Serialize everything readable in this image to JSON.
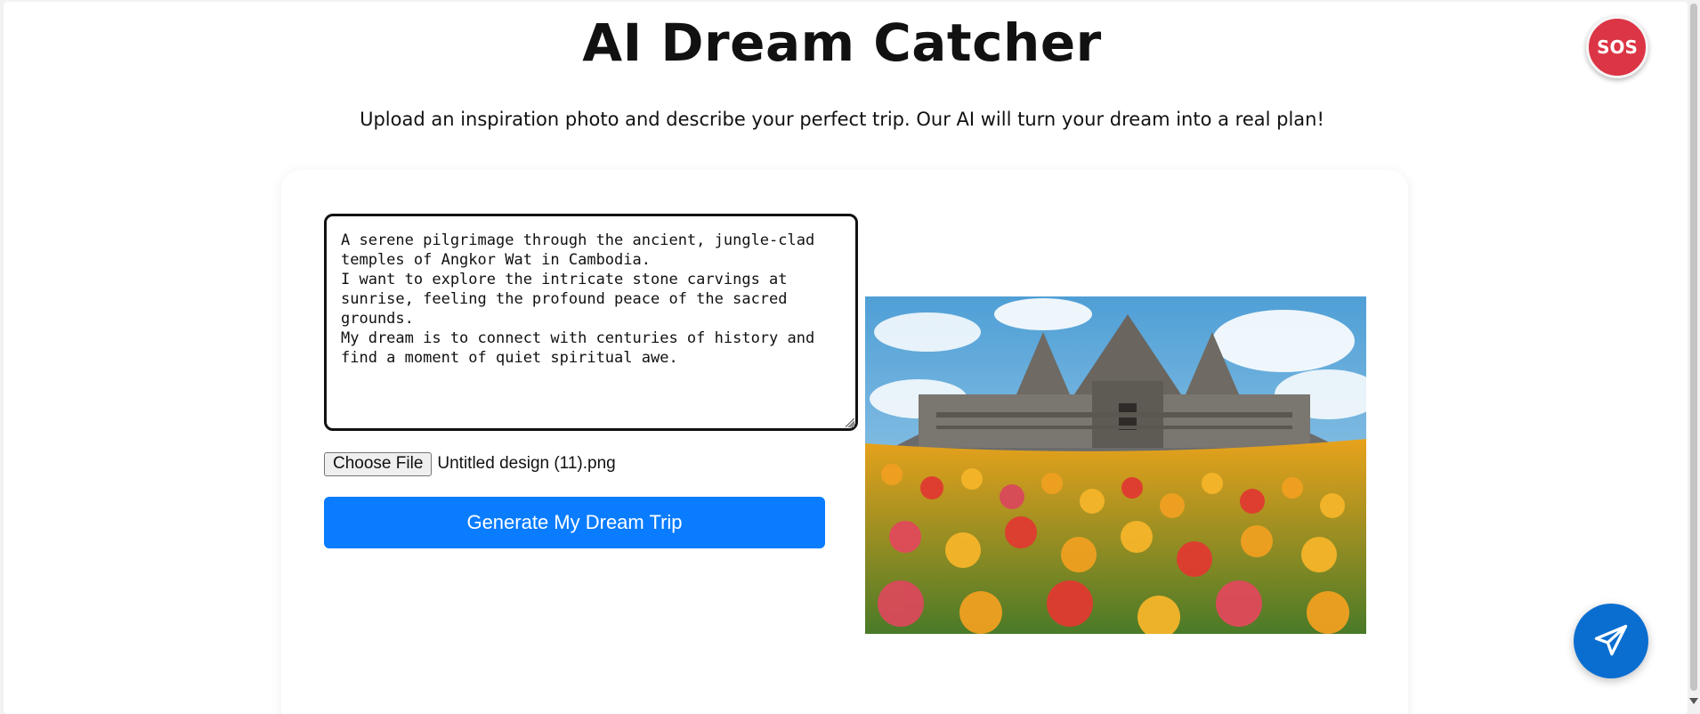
{
  "header": {
    "title": "AI Dream Catcher",
    "subtitle": "Upload an inspiration photo and describe your perfect trip. Our AI will turn your dream into a real plan!"
  },
  "form": {
    "description": "A serene pilgrimage through the ancient, jungle-clad\ntemples of Angkor Wat in Cambodia.\nI want to explore the intricate stone carvings at\nsunrise, feeling the profound peace of the sacred\ngrounds.\nMy dream is to connect with centuries of history and\nfind a moment of quiet spiritual awe.",
    "choose_file_label": "Choose File",
    "file_name": "Untitled design (11).png",
    "generate_label": "Generate My Dream Trip"
  },
  "sos": {
    "label": "SOS",
    "color": "#dc3545"
  },
  "fab": {
    "icon": "send-icon",
    "color": "#0a6ed1"
  },
  "colors": {
    "primary": "#0a7cff"
  },
  "preview": {
    "icon": "inspiration-image"
  }
}
